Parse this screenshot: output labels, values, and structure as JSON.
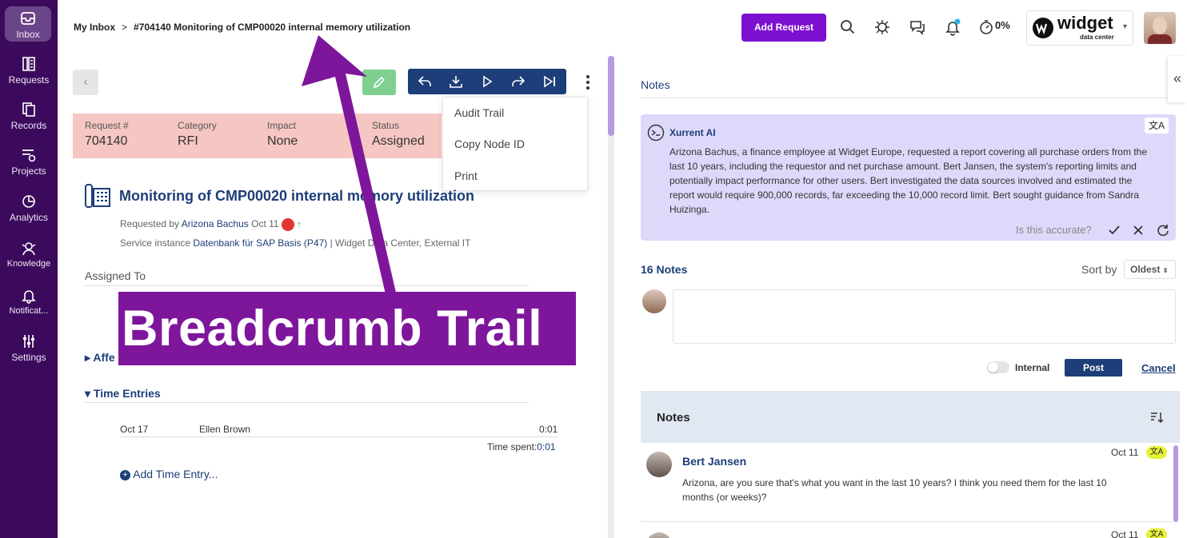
{
  "sidebar": {
    "items": [
      {
        "label": "Inbox",
        "icon": "inbox-icon"
      },
      {
        "label": "Requests",
        "icon": "requests-icon"
      },
      {
        "label": "Records",
        "icon": "records-icon"
      },
      {
        "label": "Projects",
        "icon": "projects-icon"
      },
      {
        "label": "Analytics",
        "icon": "analytics-icon"
      },
      {
        "label": "Knowledge",
        "icon": "knowledge-icon"
      },
      {
        "label": "Notificat...",
        "icon": "bell-icon"
      },
      {
        "label": "Settings",
        "icon": "settings-icon"
      }
    ],
    "active": "Inbox",
    "color": "#3b0a5c"
  },
  "header": {
    "breadcrumb_root": "My Inbox",
    "breadcrumb_current": "#704140 Monitoring of CMP00020 internal memory utilization",
    "add_request_label": "Add Request",
    "progress_label": "0%",
    "brand_name": "widget",
    "brand_sub": "data center",
    "accent": "#7c0fd0"
  },
  "request": {
    "fields": [
      {
        "label": "Request #",
        "value": "704140"
      },
      {
        "label": "Category",
        "value": "RFI"
      },
      {
        "label": "Impact",
        "value": "None"
      },
      {
        "label": "Status",
        "value": "Assigned"
      }
    ],
    "title": "Monitoring of CMP00020 internal memory utilization",
    "requested_by_label": "Requested by",
    "requester": "Arizona Bachus",
    "requested_date": "Oct 11",
    "service_instance_label": "Service instance",
    "service_instance": "Datenbank für SAP Basis (P47)",
    "service_rest": "| Widget Data Center, External IT",
    "assigned_to_label": "Assigned To",
    "affected_label": "Affe",
    "time_entries_label": "Time Entries",
    "time_entries": [
      {
        "date": "Oct 17",
        "person": "Ellen Brown",
        "amount": "0:01"
      }
    ],
    "time_spent_label": "Time spent:",
    "time_spent": "0:01",
    "add_time_label": "Add Time Entry..."
  },
  "action_menu": {
    "items": [
      "Audit Trail",
      "Copy Node ID",
      "Print"
    ]
  },
  "notes": {
    "header": "Notes",
    "ai": {
      "name": "Xurrent AI",
      "text": "Arizona Bachus, a finance employee at Widget Europe, requested a report covering all purchase orders from the last 10 years, including the requestor and net purchase amount. Bert Jansen, the system's reporting limits and potentially impact performance for other users. Bert investigated the data sources involved and estimated the report would require 900,000 records, far exceeding the 10,000 record limit. Bert sought guidance from Sandra Huizinga.",
      "accuracy_question": "Is this accurate?"
    },
    "count_label": "16 Notes",
    "sort_label": "Sort by",
    "sort_value": "Oldest",
    "internal_label": "Internal",
    "post_label": "Post",
    "cancel_label": "Cancel",
    "list_title": "Notes",
    "items": [
      {
        "author": "Bert Jansen",
        "date": "Oct 11",
        "text": "Arizona, are you sure that's what you want in the last 10 years? I think you need them for the last 10 months (or weeks)?"
      },
      {
        "author": "",
        "date": "Oct 11",
        "text": ""
      }
    ]
  },
  "overlay": {
    "label": "Breadcrumb Trail",
    "color": "#7e169c"
  }
}
